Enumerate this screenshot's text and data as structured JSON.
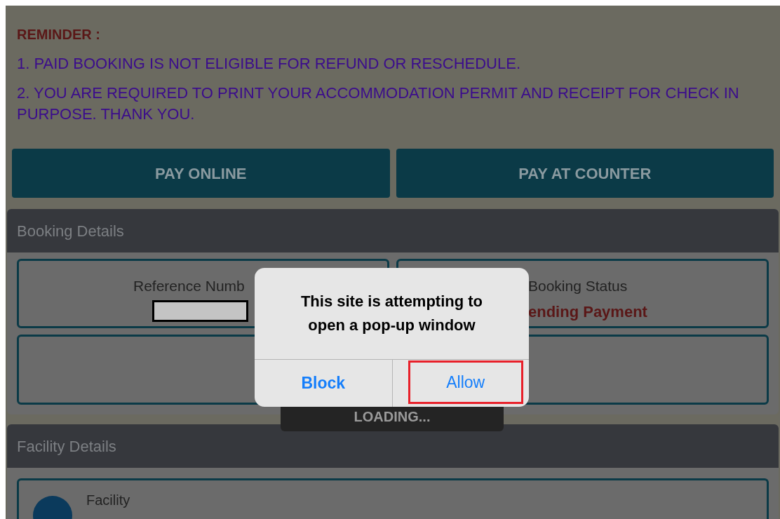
{
  "reminder": {
    "title": "REMINDER :",
    "items": [
      "1. PAID BOOKING IS NOT ELIGIBLE FOR REFUND OR RESCHEDULE.",
      "2. YOU ARE REQUIRED TO PRINT YOUR ACCOMMODATION PERMIT AND RECEIPT FOR CHECK IN PURPOSE. THANK YOU."
    ]
  },
  "actions": [
    "PAY ONLINE",
    "PAY AT COUNTER"
  ],
  "booking": {
    "title": "Booking Details",
    "reference_label": "Reference Numb",
    "status_label": "Booking Status",
    "status_value": "ending Payment"
  },
  "loading": "LOADING...",
  "facility": {
    "title": "Facility Details",
    "item_label": "Facility"
  },
  "dialog": {
    "message": "This site is attempting to open a pop-up window",
    "buttons": [
      {
        "label": "Block",
        "kind": "bold",
        "highlighted": false
      },
      {
        "label": "Allow",
        "kind": "plain",
        "highlighted": true
      }
    ]
  }
}
